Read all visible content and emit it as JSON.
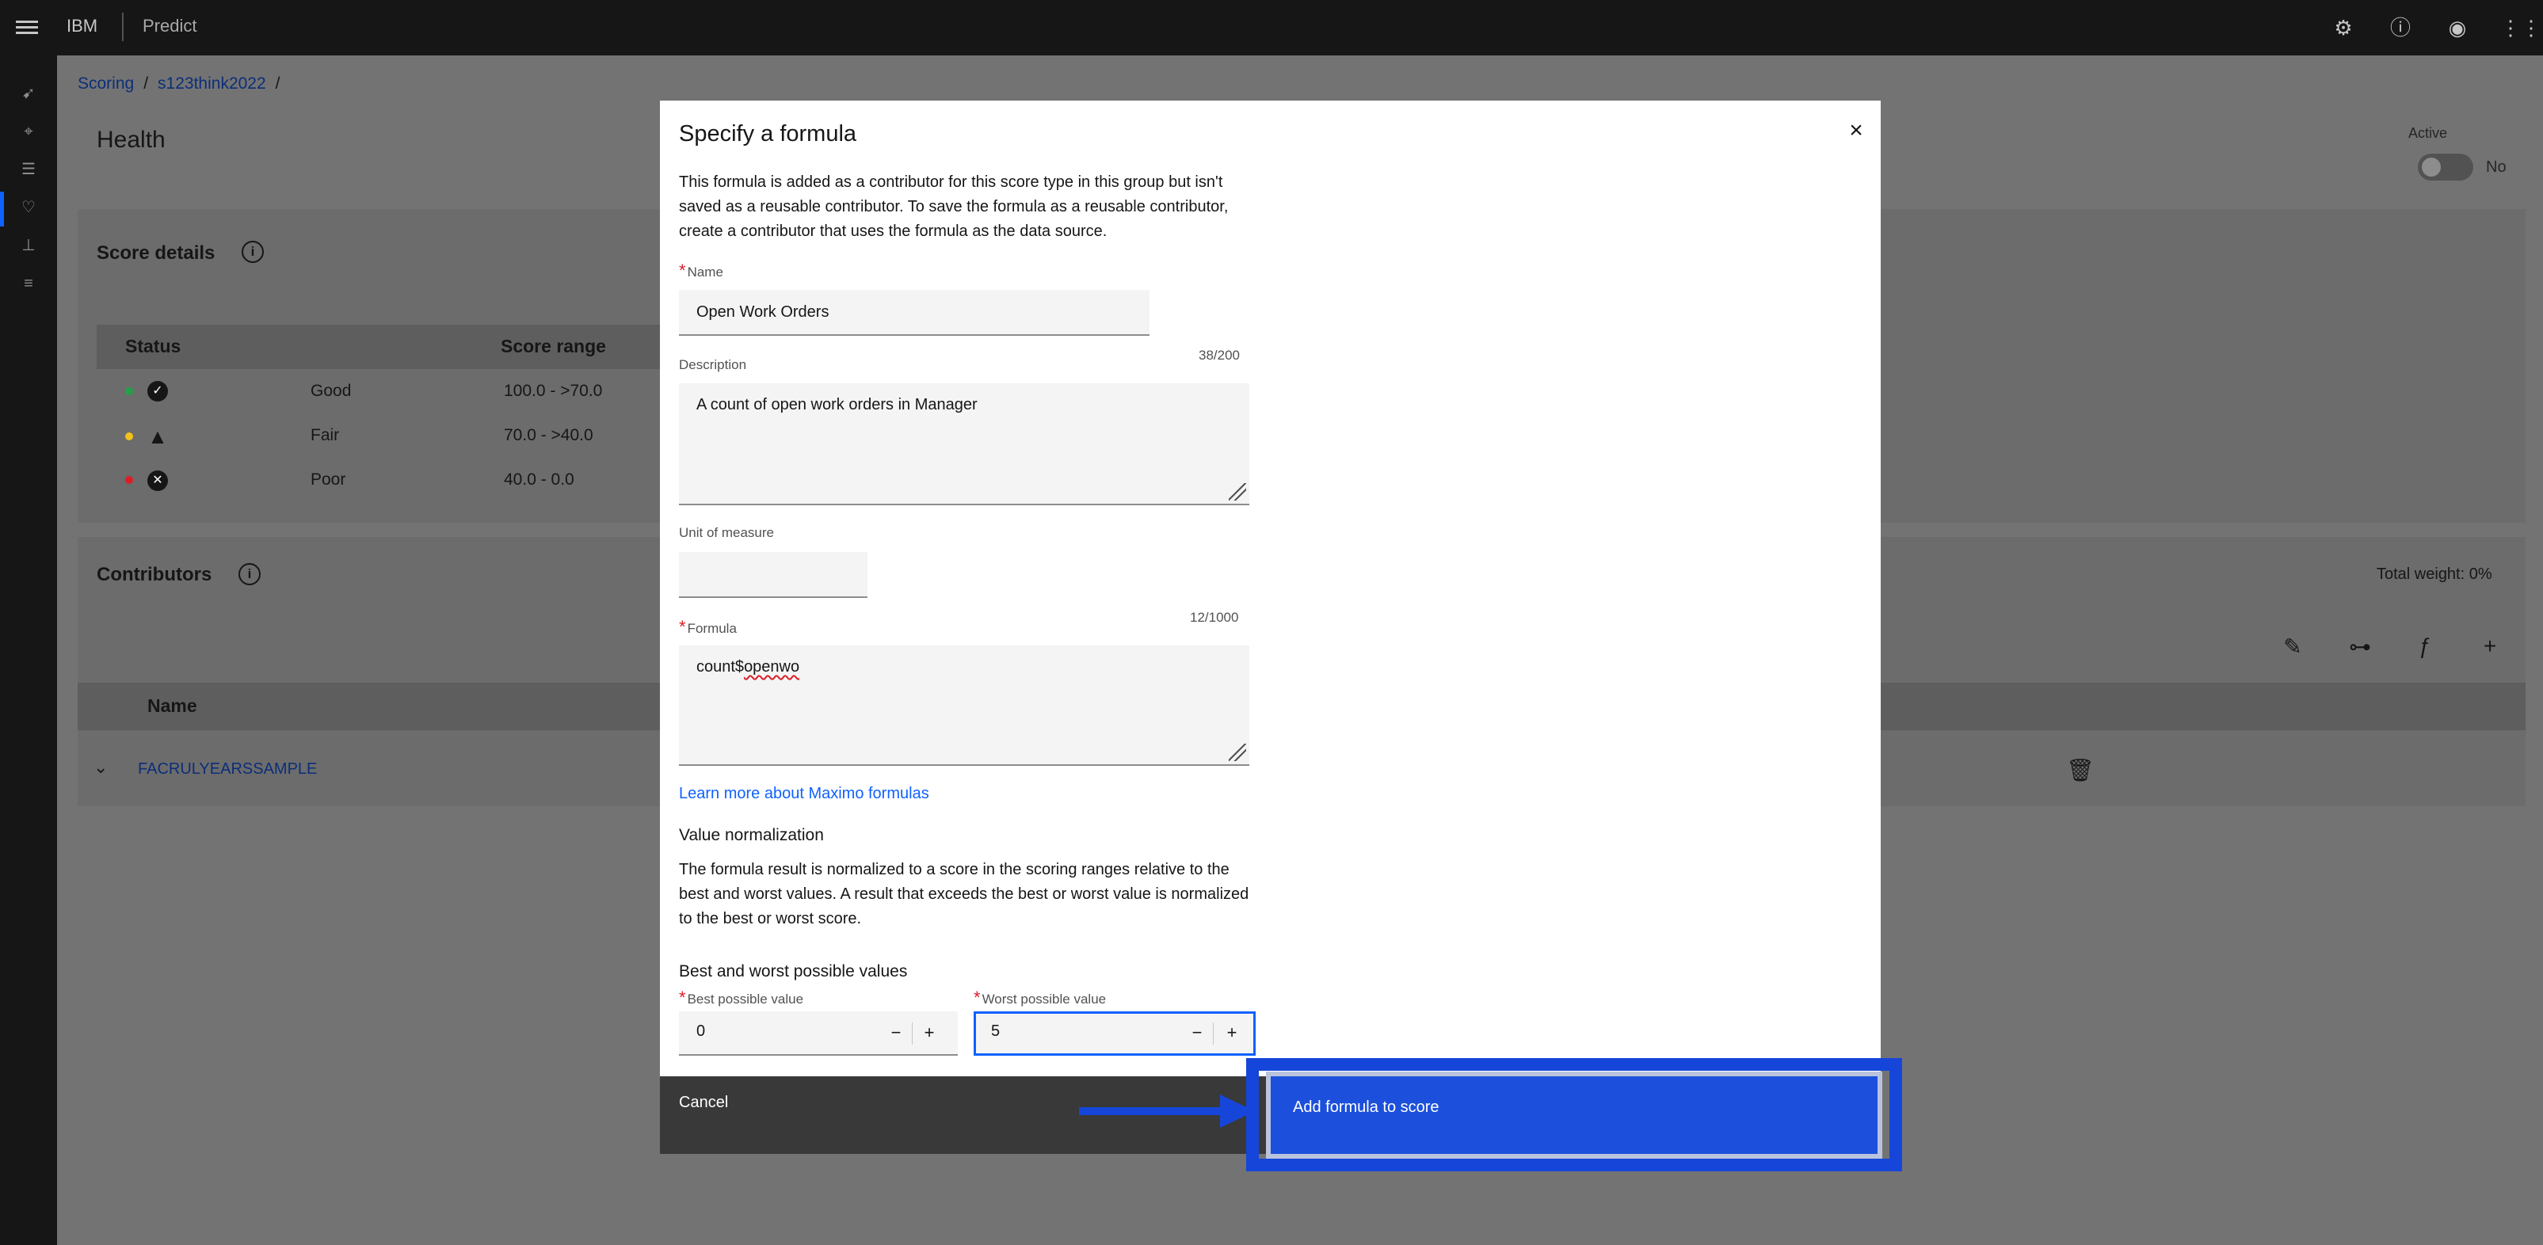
{
  "header": {
    "brand": "IBM",
    "product": "Predict",
    "icons": [
      "settings-icon",
      "help-icon",
      "user-icon",
      "app-switcher-icon"
    ]
  },
  "rail": {
    "icons": [
      "rocket-icon",
      "location-icon",
      "checklist-icon",
      "health-icon",
      "hierarchy-icon",
      "sliders-icon"
    ]
  },
  "breadcrumb": {
    "items": [
      "Scoring",
      "s123think2022"
    ]
  },
  "page": {
    "title": "Health",
    "active_label": "Active",
    "toggle_text": "No"
  },
  "score_details": {
    "title": "Score details",
    "col_status": "Status",
    "col_range": "Score range",
    "rows": [
      {
        "label": "Good",
        "range": "100.0 - >70.0",
        "color": "#24a148"
      },
      {
        "label": "Fair",
        "range": "70.0 - >40.0",
        "color": "#f1c21b"
      },
      {
        "label": "Poor",
        "range": "40.0 - 0.0",
        "color": "#da1e28"
      }
    ]
  },
  "contributors": {
    "title": "Contributors",
    "total_weight": "Total weight: 0%",
    "col_name": "Name",
    "rows": [
      {
        "name": "FACRULYEARSSAMPLE"
      }
    ]
  },
  "modal": {
    "title": "Specify a formula",
    "description": "This formula is added as a contributor for this score type in this group but isn't saved as a reusable contributor. To save the formula as a reusable contributor, create a contributor that uses the formula as the data source.",
    "name_label": "Name",
    "name_value": "Open Work Orders",
    "description_label": "Description",
    "description_counter": "38/200",
    "description_value": "A count of open work orders in Manager",
    "unit_label": "Unit of measure",
    "unit_value": "",
    "formula_label": "Formula",
    "formula_counter": "12/1000",
    "formula_prefix": "count$",
    "formula_misspelled": "openwo",
    "learn_more": "Learn more about Maximo formulas",
    "normalization_heading": "Value normalization",
    "normalization_text": "The formula result is normalized to a score in the scoring ranges relative to the best and worst values. A result that exceeds the best or worst value is normalized to the best or worst score.",
    "best_worst_heading": "Best and worst possible values",
    "best_label": "Best possible value",
    "best_value": "0",
    "worst_label": "Worst possible value",
    "worst_value": "5",
    "cancel": "Cancel",
    "primary": "Add formula to score"
  },
  "colors": {
    "accent": "#0f62fe",
    "annotation": "#1646d9",
    "required": "#da1e28"
  }
}
